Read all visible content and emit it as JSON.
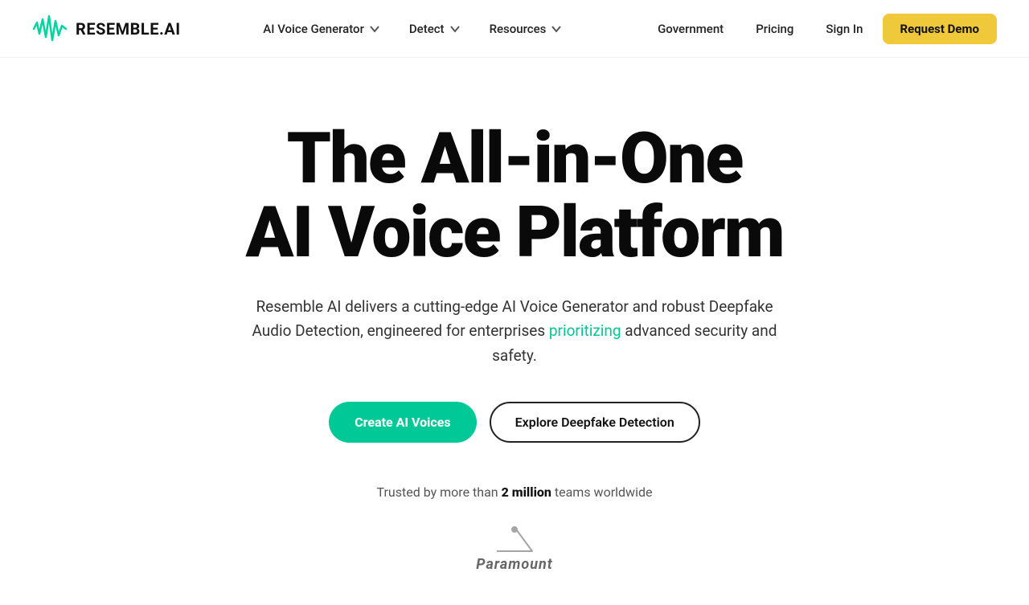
{
  "logo": {
    "brand": "RESEMBLE.AI",
    "alt": "Resemble AI Logo"
  },
  "nav": {
    "center": [
      {
        "label": "AI Voice Generator",
        "hasDropdown": true
      },
      {
        "label": "Detect",
        "hasDropdown": true
      },
      {
        "label": "Resources",
        "hasDropdown": true
      }
    ],
    "right": [
      {
        "label": "Government"
      },
      {
        "label": "Pricing"
      },
      {
        "label": "Sign In"
      }
    ],
    "cta": "Request Demo"
  },
  "hero": {
    "title_line1": "The All-in-One",
    "title_line2": "AI Voice Platform",
    "subtitle_before": "Resemble AI delivers a cutting-edge AI Voice Generator and robust Deepfake Audio Detection, engineered for enterprises ",
    "subtitle_highlight": "prioritizing",
    "subtitle_after": " advanced security and safety.",
    "btn_primary": "Create AI Voices",
    "btn_outline": "Explore Deepfake Detection"
  },
  "trust": {
    "prefix": "Trusted by more than ",
    "highlight": "2 million",
    "suffix": " teams worldwide"
  },
  "brand": {
    "name": "Paramount"
  }
}
